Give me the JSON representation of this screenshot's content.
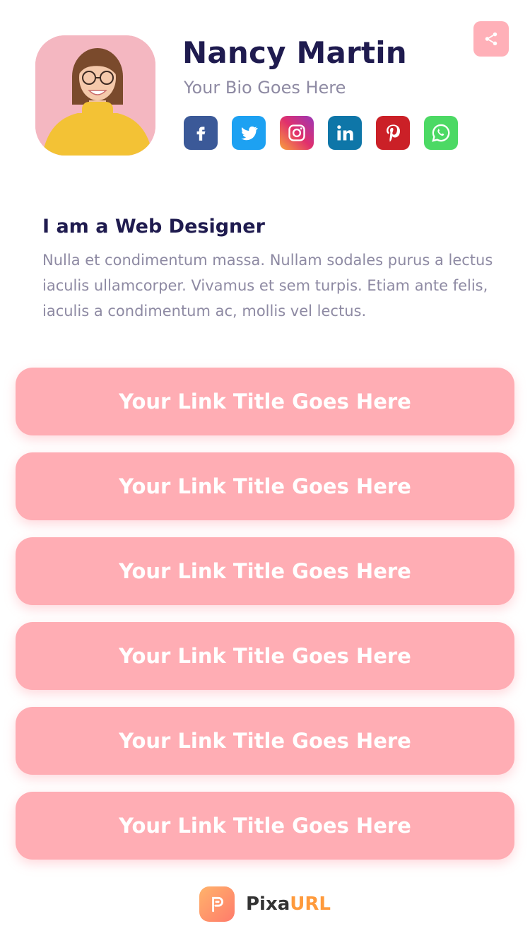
{
  "profile": {
    "name": "Nancy Martin",
    "bio": "Your Bio Goes Here"
  },
  "social": [
    {
      "name": "facebook",
      "color": "#3b5998",
      "icon": "facebook-icon"
    },
    {
      "name": "twitter",
      "color": "#1da1f2",
      "icon": "twitter-icon"
    },
    {
      "name": "instagram",
      "color": "#c13584",
      "icon": "instagram-icon"
    },
    {
      "name": "linkedin",
      "color": "#0e76a8",
      "icon": "linkedin-icon"
    },
    {
      "name": "pinterest",
      "color": "#cb2027",
      "icon": "pinterest-icon"
    },
    {
      "name": "whatsapp",
      "color": "#4cd964",
      "icon": "whatsapp-icon"
    }
  ],
  "about": {
    "title": "I am a Web Designer",
    "text": "Nulla et condimentum massa. Nullam sodales purus a lectus iaculis ullamcorper. Vivamus et sem turpis. Etiam ante felis, iaculis a condimentum ac, mollis vel lectus."
  },
  "links": [
    {
      "label": "Your Link Title Goes Here"
    },
    {
      "label": "Your Link Title Goes Here"
    },
    {
      "label": "Your Link Title Goes Here"
    },
    {
      "label": "Your Link Title Goes Here"
    },
    {
      "label": "Your Link Title Goes Here"
    },
    {
      "label": "Your Link Title Goes Here"
    }
  ],
  "footer": {
    "brand_part1": "Pixa",
    "brand_part2": "URL"
  },
  "colors": {
    "accent": "#ffadb4",
    "title": "#1f1b4f",
    "muted": "#8e8aa3",
    "brand_orange": "#ff9a3c"
  }
}
